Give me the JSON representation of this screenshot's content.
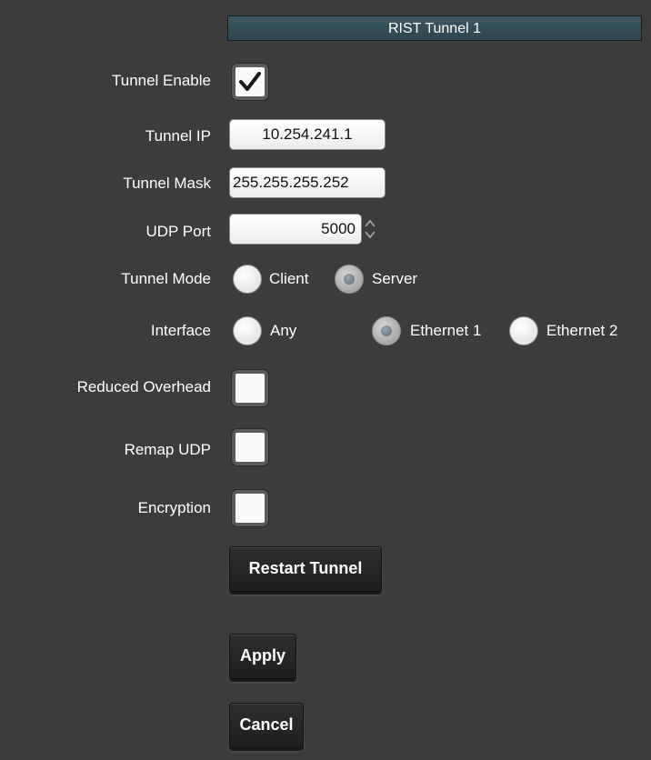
{
  "header": {
    "title": "RIST Tunnel 1"
  },
  "form": {
    "tunnel_enable": {
      "label": "Tunnel Enable",
      "checked": true
    },
    "tunnel_ip": {
      "label": "Tunnel IP",
      "value": "10.254.241.1"
    },
    "tunnel_mask": {
      "label": "Tunnel Mask",
      "value": "255.255.255.252"
    },
    "udp_port": {
      "label": "UDP Port",
      "value": "5000"
    },
    "tunnel_mode": {
      "label": "Tunnel Mode",
      "options": [
        "Client",
        "Server"
      ],
      "selected": "Server"
    },
    "interface": {
      "label": "Interface",
      "options": [
        "Any",
        "Ethernet 1",
        "Ethernet 2"
      ],
      "selected": "Ethernet 1"
    },
    "reduced_overhead": {
      "label": "Reduced Overhead",
      "checked": false
    },
    "remap_udp": {
      "label": "Remap UDP",
      "checked": false
    },
    "encryption": {
      "label": "Encryption",
      "checked": false
    }
  },
  "buttons": {
    "restart_label": "Restart Tunnel",
    "apply_label": "Apply",
    "cancel_label": "Cancel"
  },
  "icons": {
    "check": "checkmark-icon",
    "spin": "spinner-arrows-icon"
  }
}
